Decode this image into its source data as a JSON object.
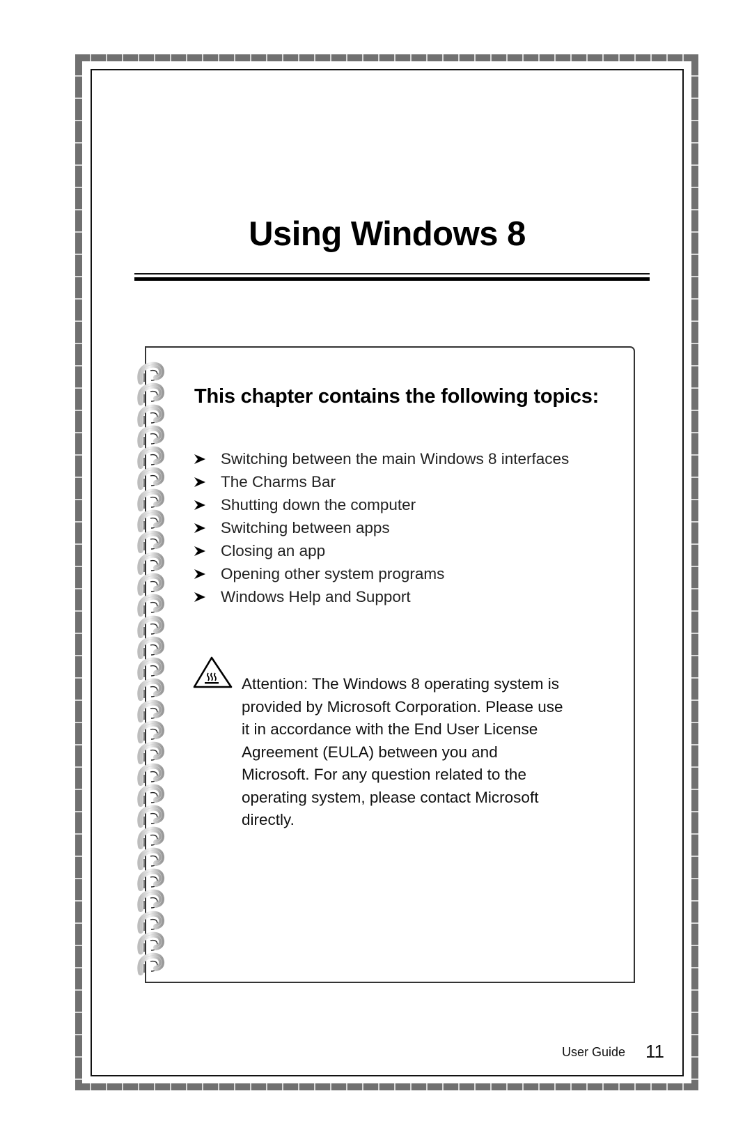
{
  "page": {
    "chapter_title": "Using Windows 8",
    "box": {
      "heading": "This chapter contains the following topics:",
      "bullet_icon": "arrowhead-bullet-icon",
      "topics": [
        "Switching between the main Windows 8 interfaces",
        "The Charms Bar",
        "Shutting down the computer",
        "Switching between apps",
        "Closing an app",
        "Opening other system programs",
        "Windows Help and Support"
      ],
      "attention": {
        "icon": "hot-surface-warning-icon",
        "text": "Attention: The Windows 8 operating system is provided by Microsoft Corporation. Please use it in accordance with the End User License Agreement (EULA) between you and Microsoft. For any question related to the operating system, please contact Microsoft directly."
      },
      "spiral_binding_icon": "spiral-coil-icon",
      "coil_count": 29
    },
    "footer": {
      "label": "User Guide",
      "page_number": "11"
    },
    "colors": {
      "border_dash": "#707070",
      "text": "#111111",
      "background": "#ffffff"
    }
  }
}
